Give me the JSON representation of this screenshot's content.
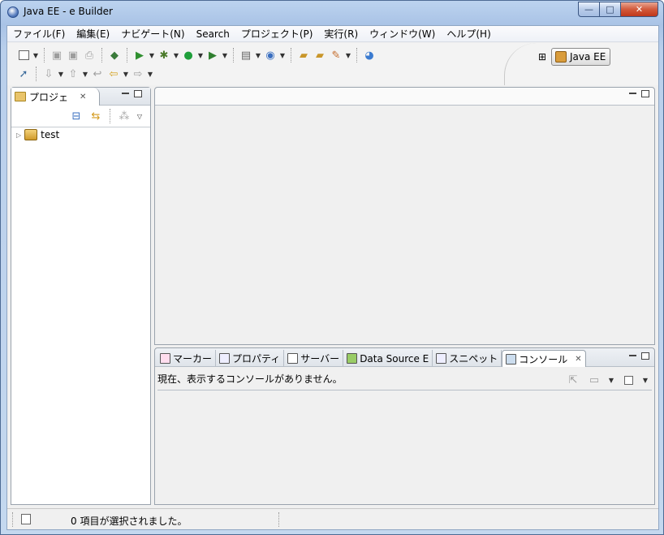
{
  "window": {
    "title": "Java EE - e Builder",
    "minimize": "—",
    "maximize": "□",
    "close": "✕"
  },
  "menu": [
    "ファイル(F)",
    "編集(E)",
    "ナビゲート(N)",
    "Search",
    "プロジェクト(P)",
    "実行(R)",
    "ウィンドウ(W)",
    "ヘルプ(H)"
  ],
  "perspective": {
    "label": "Java EE"
  },
  "project_explorer": {
    "tab_label": "プロジェ",
    "items": [
      {
        "label": "test"
      }
    ]
  },
  "bottom_panel": {
    "tabs": [
      {
        "label": "マーカー",
        "icon": "markers-icon"
      },
      {
        "label": "プロパティ",
        "icon": "properties-icon"
      },
      {
        "label": "サーバー",
        "icon": "servers-icon"
      },
      {
        "label": "Data Source E",
        "icon": "data-source-icon"
      },
      {
        "label": "スニペット",
        "icon": "snippets-icon"
      },
      {
        "label": "コンソール",
        "icon": "console-icon",
        "active": true
      }
    ],
    "message": "現在、表示するコンソールがありません。"
  },
  "status": {
    "text": "0 項目が選択されました。"
  }
}
